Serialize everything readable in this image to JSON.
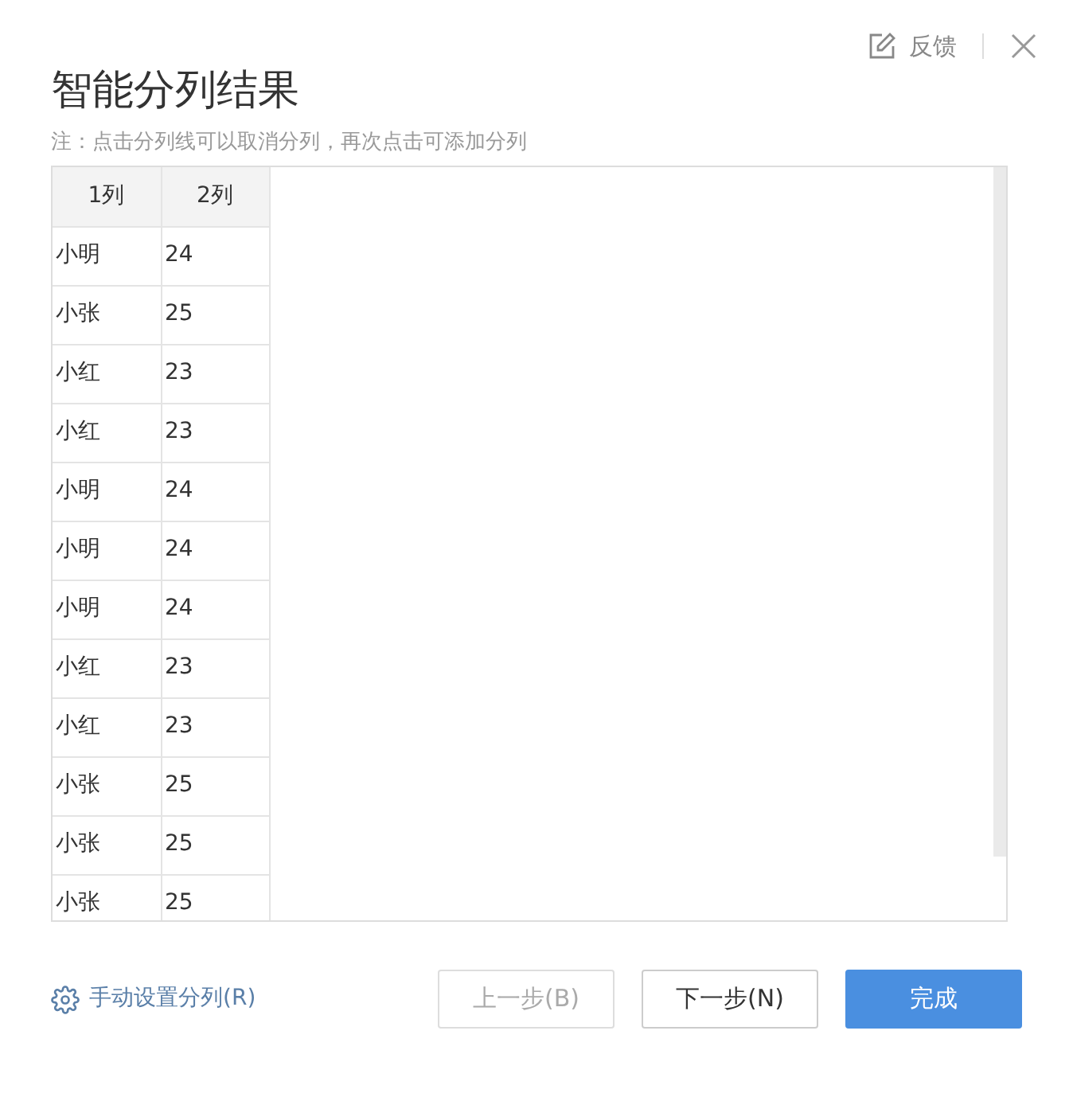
{
  "header": {
    "feedback": "反馈"
  },
  "title": "智能分列结果",
  "note": "注：点击分列线可以取消分列，再次点击可添加分列",
  "table": {
    "columns": [
      "1列",
      "2列"
    ],
    "rows": [
      [
        "小明",
        "24"
      ],
      [
        "小张",
        "25"
      ],
      [
        "小红",
        "23"
      ],
      [
        "小红",
        "23"
      ],
      [
        "小明",
        "24"
      ],
      [
        "小明",
        "24"
      ],
      [
        "小明",
        "24"
      ],
      [
        "小红",
        "23"
      ],
      [
        "小红",
        "23"
      ],
      [
        "小张",
        "25"
      ],
      [
        "小张",
        "25"
      ],
      [
        "小张",
        "25"
      ]
    ]
  },
  "footer": {
    "manual_link": "手动设置分列(R)",
    "buttons": [
      {
        "label": "上一步(B)",
        "kind": "secondary",
        "disabled": true
      },
      {
        "label": "下一步(N)",
        "kind": "secondary",
        "disabled": false
      },
      {
        "label": "完成",
        "kind": "primary",
        "disabled": false
      }
    ]
  }
}
